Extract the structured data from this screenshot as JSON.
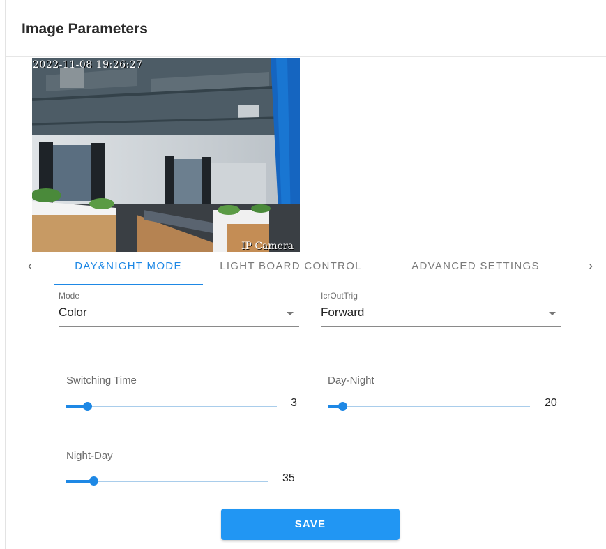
{
  "header": {
    "title": "Image Parameters"
  },
  "camera": {
    "timestamp": "2022-11-08 19:26:27",
    "overlay_label": "IP Camera"
  },
  "tabs": {
    "prev_icon": "chevron-left-icon",
    "next_icon": "chevron-right-icon",
    "items": [
      {
        "label": "DAY&NIGHT MODE",
        "active": true
      },
      {
        "label": "LIGHT BOARD CONTROL",
        "active": false
      },
      {
        "label": "ADVANCED SETTINGS",
        "active": false
      }
    ]
  },
  "form": {
    "mode": {
      "label": "Mode",
      "value": "Color"
    },
    "icrouttrig": {
      "label": "IcrOutTrig",
      "value": "Forward"
    },
    "switching_time": {
      "label": "Switching Time",
      "value": "3",
      "fraction": 0.1
    },
    "day_night": {
      "label": "Day-Night",
      "value": "20",
      "fraction": 0.07
    },
    "night_day": {
      "label": "Night-Day",
      "value": "35",
      "fraction": 0.135
    }
  },
  "actions": {
    "save_label": "SAVE"
  },
  "colors": {
    "accent": "#1e88e5",
    "button": "#2196f3",
    "track": "#a9cdeb"
  }
}
